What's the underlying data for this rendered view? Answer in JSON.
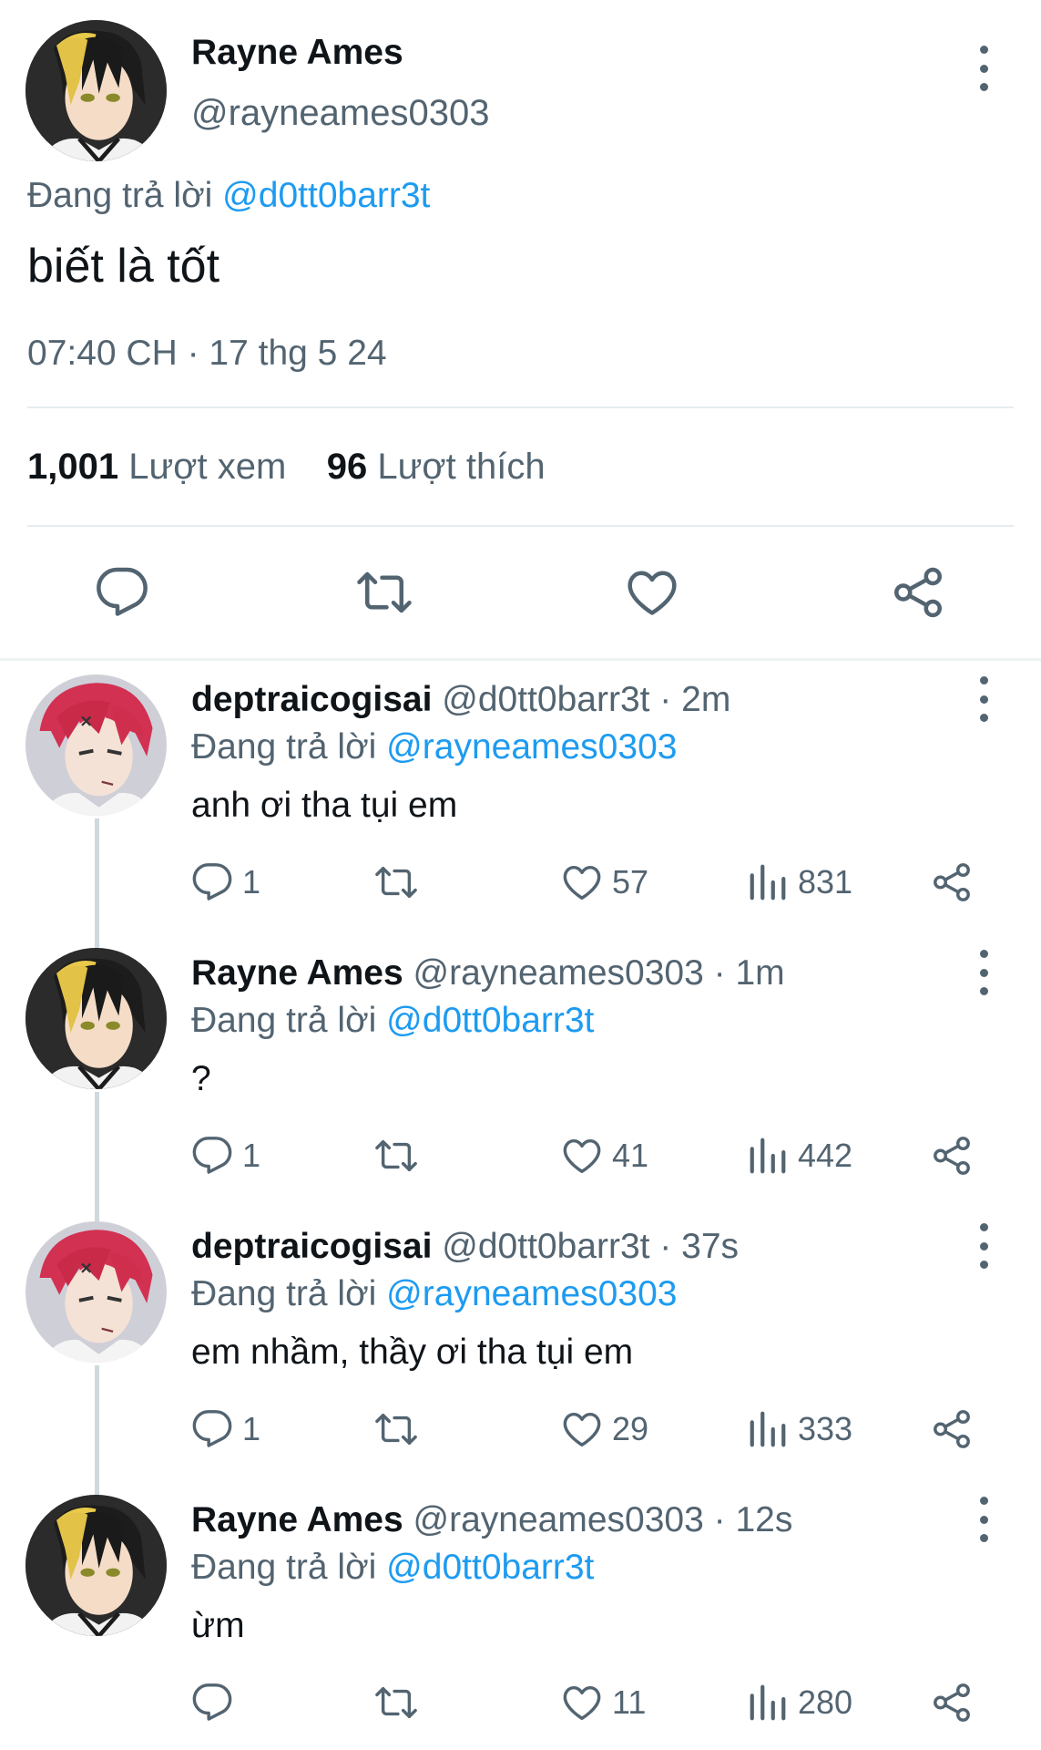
{
  "main_tweet": {
    "author_name": "Rayne Ames",
    "handle": "@rayneames0303",
    "replying_prefix": "Đang trả lời",
    "replying_to": "@d0tt0barr3t",
    "text": "biết là tốt",
    "timestamp": "07:40 CH · 17 thg 5 24",
    "views_count": "1,001",
    "views_label": "Lượt xem",
    "likes_count": "96",
    "likes_label": "Lượt thích"
  },
  "colors": {
    "accent": "#1d9bf0",
    "secondary_text": "#536471",
    "primary_text": "#0f1419"
  },
  "replies": [
    {
      "author_name": "deptraicogisai",
      "meta": "@d0tt0barr3t · 2m",
      "replying_prefix": "Đang trả lời",
      "replying_to": "@rayneames0303",
      "text": "anh ơi tha tụi em",
      "reply_count": "1",
      "like_count": "57",
      "view_count": "831"
    },
    {
      "author_name": "Rayne Ames",
      "meta": "@rayneames0303 · 1m",
      "replying_prefix": "Đang trả lời",
      "replying_to": "@d0tt0barr3t",
      "text": "?",
      "reply_count": "1",
      "like_count": "41",
      "view_count": "442"
    },
    {
      "author_name": "deptraicogisai",
      "meta": "@d0tt0barr3t · 37s",
      "replying_prefix": "Đang trả lời",
      "replying_to": "@rayneames0303",
      "text": "em nhầm, thầy ơi tha tụi em",
      "reply_count": "1",
      "like_count": "29",
      "view_count": "333"
    },
    {
      "author_name": "Rayne Ames",
      "meta": "@rayneames0303 · 12s",
      "replying_prefix": "Đang trả lời",
      "replying_to": "@d0tt0barr3t",
      "text": "ừm",
      "like_count": "11",
      "view_count": "280"
    }
  ]
}
